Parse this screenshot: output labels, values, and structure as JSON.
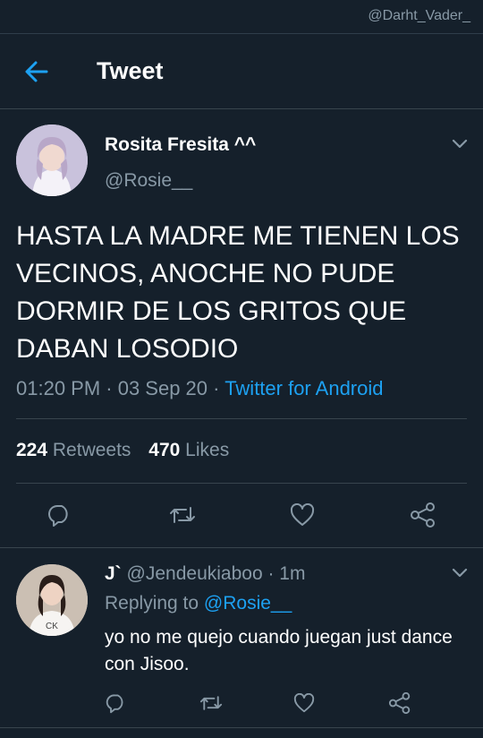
{
  "watermark": "@Darht_Vader_",
  "header": {
    "title": "Tweet"
  },
  "tweet": {
    "display_name": "Rosita Fresita ^^",
    "handle": "@Rosie__",
    "text": "HASTA LA MADRE ME TIENEN LOS VECINOS, ANOCHE NO PUDE DORMIR DE LOS GRITOS QUE DABAN LOSODIO",
    "time": "01:20 PM · 03 Sep 20 · ",
    "source": "Twitter for Android",
    "retweets_count": "224",
    "retweets_label": "Retweets",
    "likes_count": "470",
    "likes_label": "Likes"
  },
  "reply": {
    "display_name": "J`",
    "handle_time": "@Jendeukiaboo · 1m",
    "replying_prefix": "Replying to ",
    "replying_to": "@Rosie__",
    "text": "yo no me quejo cuando juegan just dance con Jisoo."
  },
  "colors": {
    "background": "#15202b",
    "secondary_text": "#8899a6",
    "accent": "#1da1f2",
    "divider": "#38444d"
  },
  "icons": [
    "back-arrow-icon",
    "chevron-down-icon",
    "reply-icon",
    "retweet-icon",
    "like-icon",
    "share-icon"
  ]
}
